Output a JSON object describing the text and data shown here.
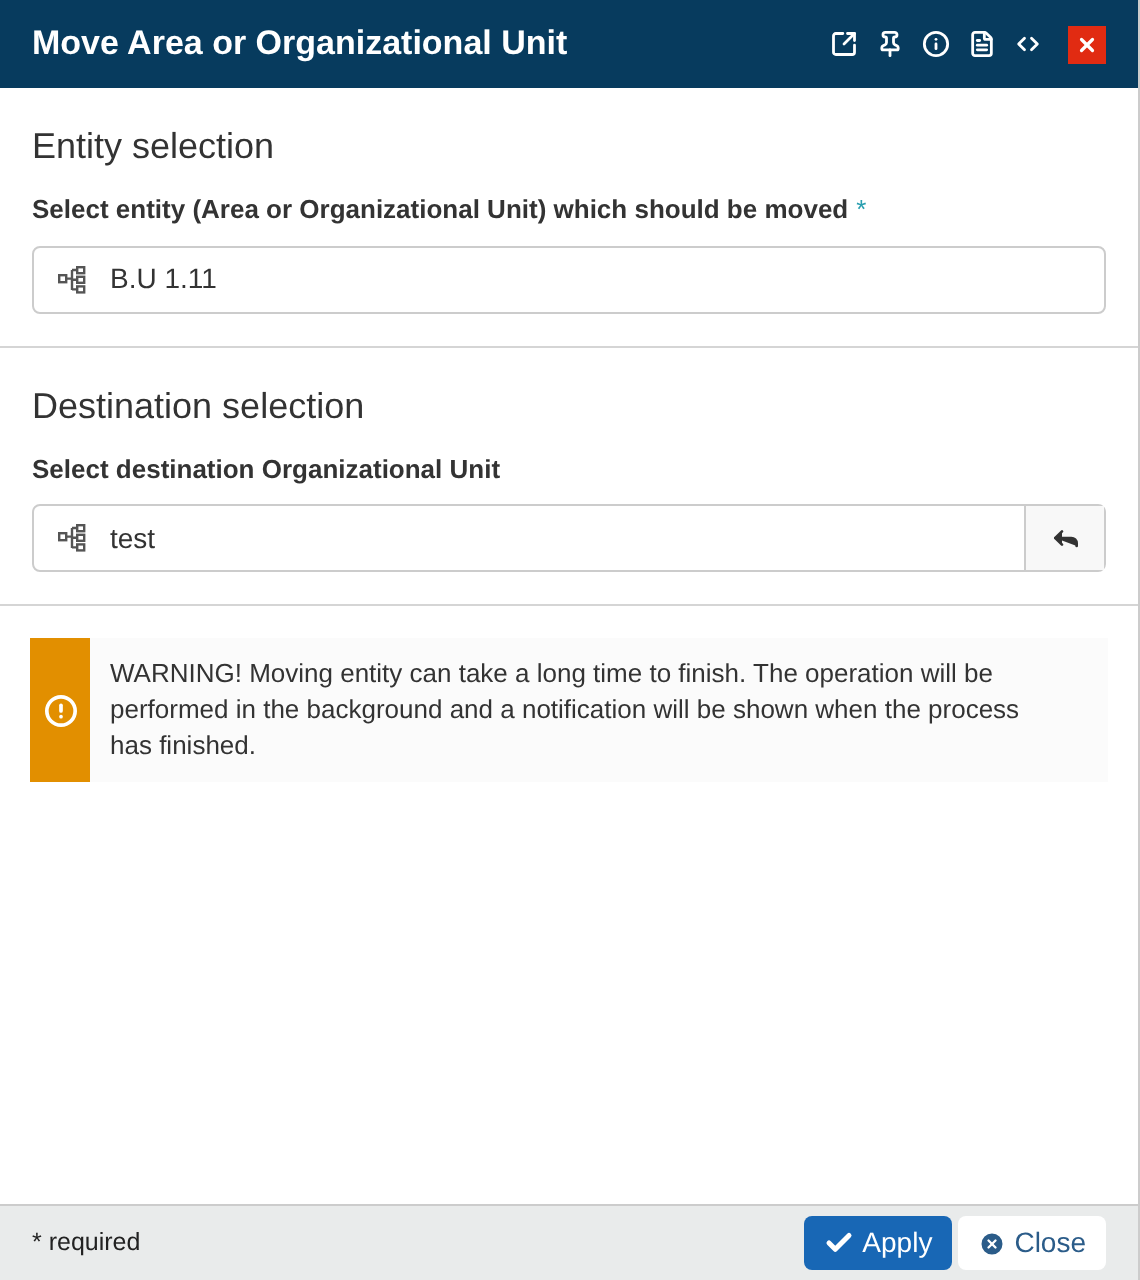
{
  "window": {
    "title": "Move Area or Organizational Unit"
  },
  "sections": [
    {
      "heading": "Entity selection",
      "label": "Select entity (Area or Organizational Unit) which should be moved",
      "required_mark": "*",
      "value": "B.U 1.11",
      "has_reset": false
    },
    {
      "heading": "Destination selection",
      "label": "Select destination Organizational Unit",
      "value": "test",
      "has_reset": true
    }
  ],
  "warning": {
    "text": "WARNING! Moving entity can take a long time to finish. The operation will be performed in the background and a notification will be shown when the process has finished."
  },
  "footer": {
    "note": "* required",
    "buttons": [
      {
        "label": "Apply",
        "kind": "primary"
      },
      {
        "label": "Close",
        "kind": "secondary"
      }
    ]
  }
}
